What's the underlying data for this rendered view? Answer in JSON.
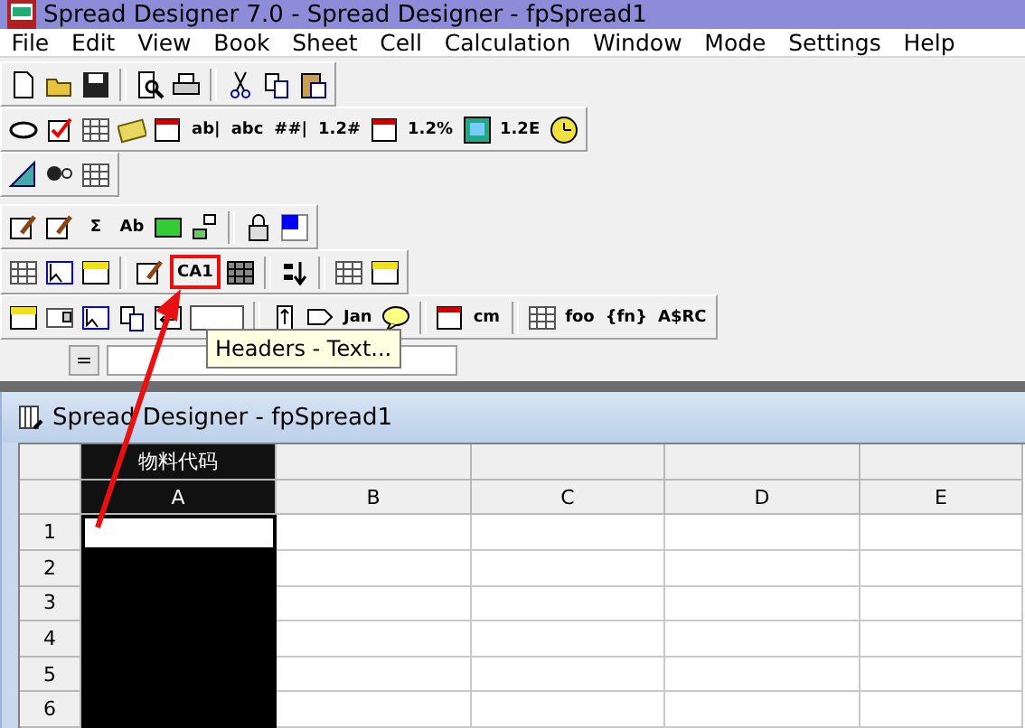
{
  "window": {
    "title": "Spread Designer 7.0 - Spread Designer - fpSpread1"
  },
  "menu": [
    "File",
    "Edit",
    "View",
    "Book",
    "Sheet",
    "Cell",
    "Calculation",
    "Window",
    "Mode",
    "Settings",
    "Help"
  ],
  "toolbars": [
    [
      {
        "kind": "icon"
      },
      {
        "kind": "icon"
      },
      {
        "kind": "icon"
      },
      {
        "kind": "separator"
      },
      {
        "kind": "icon"
      },
      {
        "kind": "icon"
      },
      {
        "kind": "separator"
      },
      {
        "kind": "icon"
      },
      {
        "kind": "icon"
      },
      {
        "kind": "icon"
      }
    ],
    [
      {
        "kind": "icon"
      },
      {
        "kind": "icon"
      },
      {
        "kind": "icon"
      },
      {
        "kind": "icon"
      },
      {
        "kind": "icon"
      },
      {
        "kind": "glyph",
        "label": "ab|"
      },
      {
        "kind": "glyph",
        "label": "abc"
      },
      {
        "kind": "glyph",
        "label": "##|"
      },
      {
        "kind": "glyph",
        "label": "1.2#"
      },
      {
        "kind": "icon"
      },
      {
        "kind": "glyph",
        "label": "1.2%"
      },
      {
        "kind": "icon"
      },
      {
        "kind": "glyph",
        "label": "1.2E"
      },
      {
        "kind": "icon"
      }
    ],
    [
      {
        "kind": "icon"
      },
      {
        "kind": "icon"
      },
      {
        "kind": "icon"
      }
    ],
    [
      {
        "kind": "icon"
      },
      {
        "kind": "icon"
      },
      {
        "kind": "glyph",
        "label": "Σ"
      },
      {
        "kind": "glyph",
        "label": "Ab"
      },
      {
        "kind": "icon"
      },
      {
        "kind": "icon"
      },
      {
        "kind": "separator"
      },
      {
        "kind": "icon"
      },
      {
        "kind": "icon"
      }
    ],
    [
      {
        "kind": "icon",
        "highlighted": false
      },
      {
        "kind": "icon",
        "highlighted": false
      },
      {
        "kind": "icon",
        "highlighted": false
      },
      {
        "kind": "separator"
      },
      {
        "kind": "icon",
        "highlighted": false
      },
      {
        "kind": "glyph",
        "label": "CA1",
        "highlighted": true
      },
      {
        "kind": "icon",
        "highlighted": false
      },
      {
        "kind": "separator"
      },
      {
        "kind": "icon",
        "highlighted": false
      },
      {
        "kind": "separator"
      },
      {
        "kind": "icon",
        "highlighted": false
      },
      {
        "kind": "icon",
        "highlighted": false
      }
    ],
    [
      {
        "kind": "icon"
      },
      {
        "kind": "icon"
      },
      {
        "kind": "icon"
      },
      {
        "kind": "icon"
      },
      {
        "kind": "icon"
      },
      {
        "kind": "icon"
      },
      {
        "kind": "separator"
      },
      {
        "kind": "icon"
      },
      {
        "kind": "icon"
      },
      {
        "kind": "glyph",
        "label": "Jan"
      },
      {
        "kind": "icon"
      },
      {
        "kind": "separator"
      },
      {
        "kind": "icon"
      },
      {
        "kind": "glyph",
        "label": "cm"
      },
      {
        "kind": "separator"
      },
      {
        "kind": "icon"
      },
      {
        "kind": "glyph",
        "label": "foo"
      },
      {
        "kind": "glyph",
        "label": "{fn}"
      },
      {
        "kind": "glyph",
        "label": "A$RC"
      }
    ]
  ],
  "tooltip": "Headers - Text...",
  "formula_bar": {
    "button": "="
  },
  "sheet_window": {
    "title": "Spread Designer - fpSpread1"
  },
  "sheet": {
    "columns": [
      {
        "header_text": "物料代码",
        "letter": "A",
        "selected": true
      },
      {
        "letter": "B",
        "selected": false
      },
      {
        "letter": "C",
        "selected": false
      },
      {
        "letter": "D",
        "selected": false
      },
      {
        "letter": "E",
        "selected": false
      }
    ],
    "rows": [
      {
        "number": "1",
        "active": true
      },
      {
        "number": "2",
        "active": false
      },
      {
        "number": "3",
        "active": false
      },
      {
        "number": "4",
        "active": false
      },
      {
        "number": "5",
        "active": false
      },
      {
        "number": "6",
        "active": false
      }
    ]
  }
}
